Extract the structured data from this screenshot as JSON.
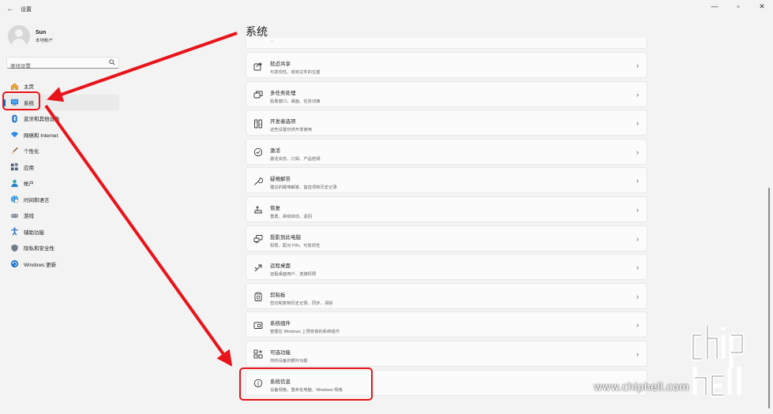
{
  "window": {
    "title": "设置",
    "controls": [
      "—",
      "▫",
      "✕"
    ]
  },
  "user": {
    "name": "Sun",
    "account_type": "本地帐户"
  },
  "search": {
    "placeholder": "查找设置"
  },
  "sidebar": {
    "items": [
      {
        "label": "主页",
        "icon": "home-icon"
      },
      {
        "label": "系统",
        "icon": "system-monitor-icon",
        "active": true
      },
      {
        "label": "蓝牙和其他设备",
        "icon": "bluetooth-icon"
      },
      {
        "label": "网络和 Internet",
        "icon": "wifi-icon"
      },
      {
        "label": "个性化",
        "icon": "brush-icon"
      },
      {
        "label": "应用",
        "icon": "apps-icon"
      },
      {
        "label": "帐户",
        "icon": "account-icon"
      },
      {
        "label": "时间和语言",
        "icon": "globe-clock-icon"
      },
      {
        "label": "游戏",
        "icon": "gamepad-icon"
      },
      {
        "label": "辅助功能",
        "icon": "accessibility-icon"
      },
      {
        "label": "隐私和安全性",
        "icon": "shield-icon"
      },
      {
        "label": "Windows 更新",
        "icon": "windows-update-icon"
      }
    ]
  },
  "main": {
    "title": "系统",
    "cut_off_subtitle": "…",
    "cards": [
      {
        "title": "就近共享",
        "subtitle": "可发现性、收到文件的位置",
        "icon": "share-icon"
      },
      {
        "title": "多任务处理",
        "subtitle": "贴靠窗口、桌面、任务切换",
        "icon": "multitask-icon"
      },
      {
        "title": "开发者选项",
        "subtitle": "这些设置仅供开发使用",
        "icon": "developer-icon"
      },
      {
        "title": "激活",
        "subtitle": "激活状态、订阅、产品密钥",
        "icon": "check-circle-icon"
      },
      {
        "title": "疑难解答",
        "subtitle": "建议的疑难解答、首选项和历史记录",
        "icon": "wrench-icon"
      },
      {
        "title": "恢复",
        "subtitle": "重置、高级启动、返回",
        "icon": "recovery-icon"
      },
      {
        "title": "投影到此电脑",
        "subtitle": "权限、配对 PIN、可发现性",
        "icon": "projection-icon"
      },
      {
        "title": "远程桌面",
        "subtitle": "远程桌面用户、连接权限",
        "icon": "remote-desktop-icon"
      },
      {
        "title": "剪贴板",
        "subtitle": "剪切和复制历史记录、同步、清除",
        "icon": "clipboard-icon"
      },
      {
        "title": "系统组件",
        "subtitle": "管理在 Windows 上预安装的系统组件",
        "icon": "components-icon"
      },
      {
        "title": "可选功能",
        "subtitle": "你的设备的额外功能",
        "icon": "optional-features-icon"
      },
      {
        "title": "系统信息",
        "subtitle": "设备规格、重命名电脑、Windows 规格",
        "icon": "info-icon"
      }
    ]
  },
  "annotation": {
    "color": "#e8141a"
  },
  "watermark": {
    "text": "www.chiphell.com",
    "logo_text": "chiphell"
  },
  "colors": {
    "accent": "#0067c0",
    "background": "#f3f3f3",
    "card": "#fbfbfb"
  }
}
